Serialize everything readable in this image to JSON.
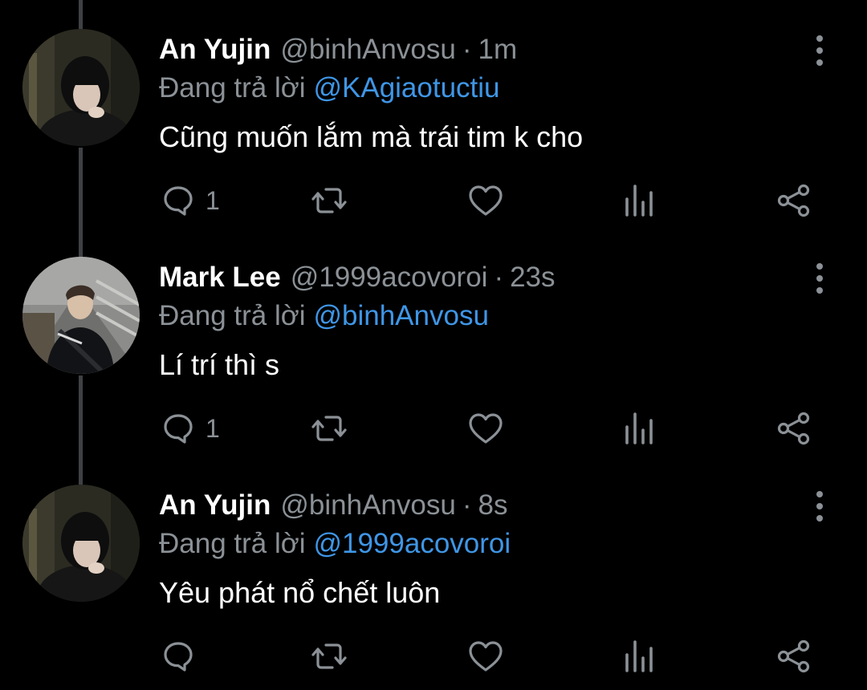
{
  "tweets": [
    {
      "name": "An Yujin",
      "handle": "@binhAnvosu",
      "separator": "·",
      "time": "1m",
      "replying_label": "Đang trả lời",
      "replying_to": "@KAgiaotuctiu",
      "text": "Cũng muốn lắm mà trái tim k cho",
      "reply_count": "1",
      "avatar_icon": "avatar-girl-photo"
    },
    {
      "name": "Mark Lee",
      "handle": "@1999acovoroi",
      "separator": "·",
      "time": "23s",
      "replying_label": "Đang trả lời",
      "replying_to": "@binhAnvosu",
      "text": "Lí trí thì s",
      "reply_count": "1",
      "avatar_icon": "avatar-boy-photo"
    },
    {
      "name": "An Yujin",
      "handle": "@binhAnvosu",
      "separator": "·",
      "time": "8s",
      "replying_label": "Đang trả lời",
      "replying_to": "@1999acovoroi",
      "text": "Yêu phát nổ chết luôn",
      "reply_count": "",
      "avatar_icon": "avatar-girl-photo"
    }
  ],
  "colors": {
    "background": "#000000",
    "name": "#ffffff",
    "muted": "#8b9196",
    "mention": "#3f96e6",
    "thread_line": "#3e4144"
  },
  "icons": [
    "reply-icon",
    "retweet-icon",
    "like-icon",
    "views-icon",
    "share-icon",
    "more-options-icon"
  ]
}
